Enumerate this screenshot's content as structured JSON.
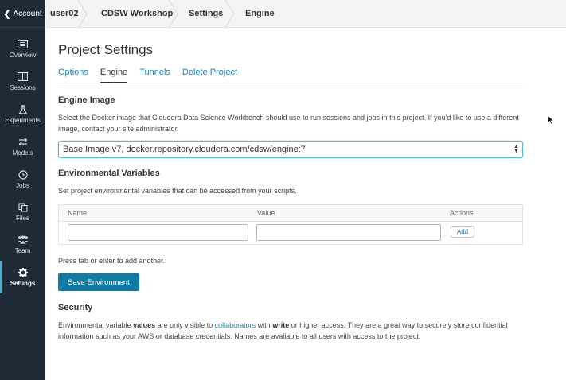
{
  "sidebar": {
    "account_label": "Account",
    "items": [
      {
        "label": "Overview",
        "icon": "overview-icon"
      },
      {
        "label": "Sessions",
        "icon": "sessions-icon"
      },
      {
        "label": "Experiments",
        "icon": "experiments-icon"
      },
      {
        "label": "Models",
        "icon": "models-icon"
      },
      {
        "label": "Jobs",
        "icon": "jobs-icon"
      },
      {
        "label": "Files",
        "icon": "files-icon"
      },
      {
        "label": "Team",
        "icon": "team-icon"
      },
      {
        "label": "Settings",
        "icon": "gear-icon"
      }
    ],
    "active_item": "Settings",
    "accent_color": "#3fb1ce"
  },
  "breadcrumb": [
    "user02",
    "CDSW Workshop",
    "Settings",
    "Engine"
  ],
  "page_title": "Project Settings",
  "tabs": [
    "Options",
    "Engine",
    "Tunnels",
    "Delete Project"
  ],
  "active_tab": "Engine",
  "engine_image": {
    "heading": "Engine Image",
    "description": "Select the Docker image that Cloudera Data Science Workbench should use to run sessions and jobs in this project. If you'd like to use a different image, contact your site administrator.",
    "selected_value": "Base Image v7, docker.repository.cloudera.com/cdsw/engine:7"
  },
  "env_vars": {
    "heading": "Environmental Variables",
    "description": "Set project environmental variables that can be accessed from your scripts.",
    "columns": {
      "name": "Name",
      "value": "Value",
      "actions": "Actions"
    },
    "name_value": "",
    "value_value": "",
    "add_label": "Add",
    "hint": "Press tab or enter to add another.",
    "save_label": "Save Environment"
  },
  "security": {
    "heading": "Security",
    "text_1": "Environmental variable ",
    "bold_1": "values",
    "text_2": " are only visible to ",
    "link": "collaborators",
    "text_3": " with ",
    "bold_2": "write",
    "text_4": " or higher access. They are a great way to securely store confidential information such as your AWS or database credentials. Names are available to all users with access to the project."
  },
  "colors": {
    "primary_button": "#127ba4",
    "link": "#1f7fac",
    "sidebar_bg": "#1e2a36"
  }
}
